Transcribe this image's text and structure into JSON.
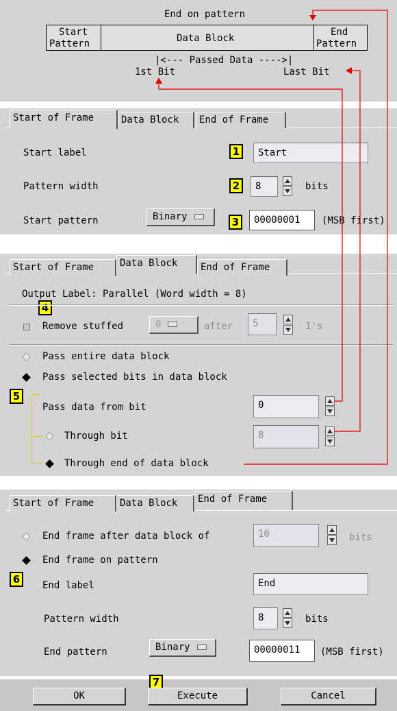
{
  "diagram": {
    "title": "End on pattern",
    "start_pattern_line1": "Start",
    "start_pattern_line2": "Pattern",
    "data_block": "Data Block",
    "end_pattern_line1": "End",
    "end_pattern_line2": "Pattern",
    "passed_data": "|<--- Passed Data ---->|",
    "first_bit": "1st Bit",
    "last_bit": "Last Bit"
  },
  "tabs": {
    "start": "Start of Frame",
    "data": "Data Block",
    "end": "End of Frame"
  },
  "panel1": {
    "start_label": "Start label",
    "start_label_value": "Start",
    "pattern_width": "Pattern width",
    "pattern_width_value": "8",
    "bits": "bits",
    "start_pattern": "Start pattern",
    "format": "Binary",
    "pattern_value": "00000001",
    "msb": "(MSB first)"
  },
  "panel2": {
    "output_label": "Output Label: Parallel (Word width = 8)",
    "remove_stuffed": "Remove stuffed",
    "stuffed_value": "0",
    "after": "after",
    "after_value": "5",
    "ones": "1's",
    "pass_entire": "Pass entire data block",
    "pass_selected": "Pass selected bits in data block",
    "pass_from": "Pass data from bit",
    "pass_from_value": "0",
    "through_bit": "Through bit",
    "through_bit_value": "8",
    "through_end": "Through end of data block"
  },
  "panel3": {
    "end_after": "End frame after data block of",
    "end_after_value": "10",
    "bits": "bits",
    "end_on_pattern": "End frame on pattern",
    "end_label": "End label",
    "end_label_value": "End",
    "pattern_width": "Pattern width",
    "pattern_width_value": "8",
    "pw_bits": "bits",
    "end_pattern": "End pattern",
    "format": "Binary",
    "pattern_value": "00000011",
    "msb": "(MSB first)"
  },
  "buttons": {
    "ok": "OK",
    "execute": "Execute",
    "cancel": "Cancel"
  },
  "callouts": [
    "1",
    "2",
    "3",
    "4",
    "5",
    "6",
    "7"
  ],
  "colors": {
    "panel": "#d4d4d4",
    "arrow": "#e00000",
    "callout": "#ffff00"
  }
}
